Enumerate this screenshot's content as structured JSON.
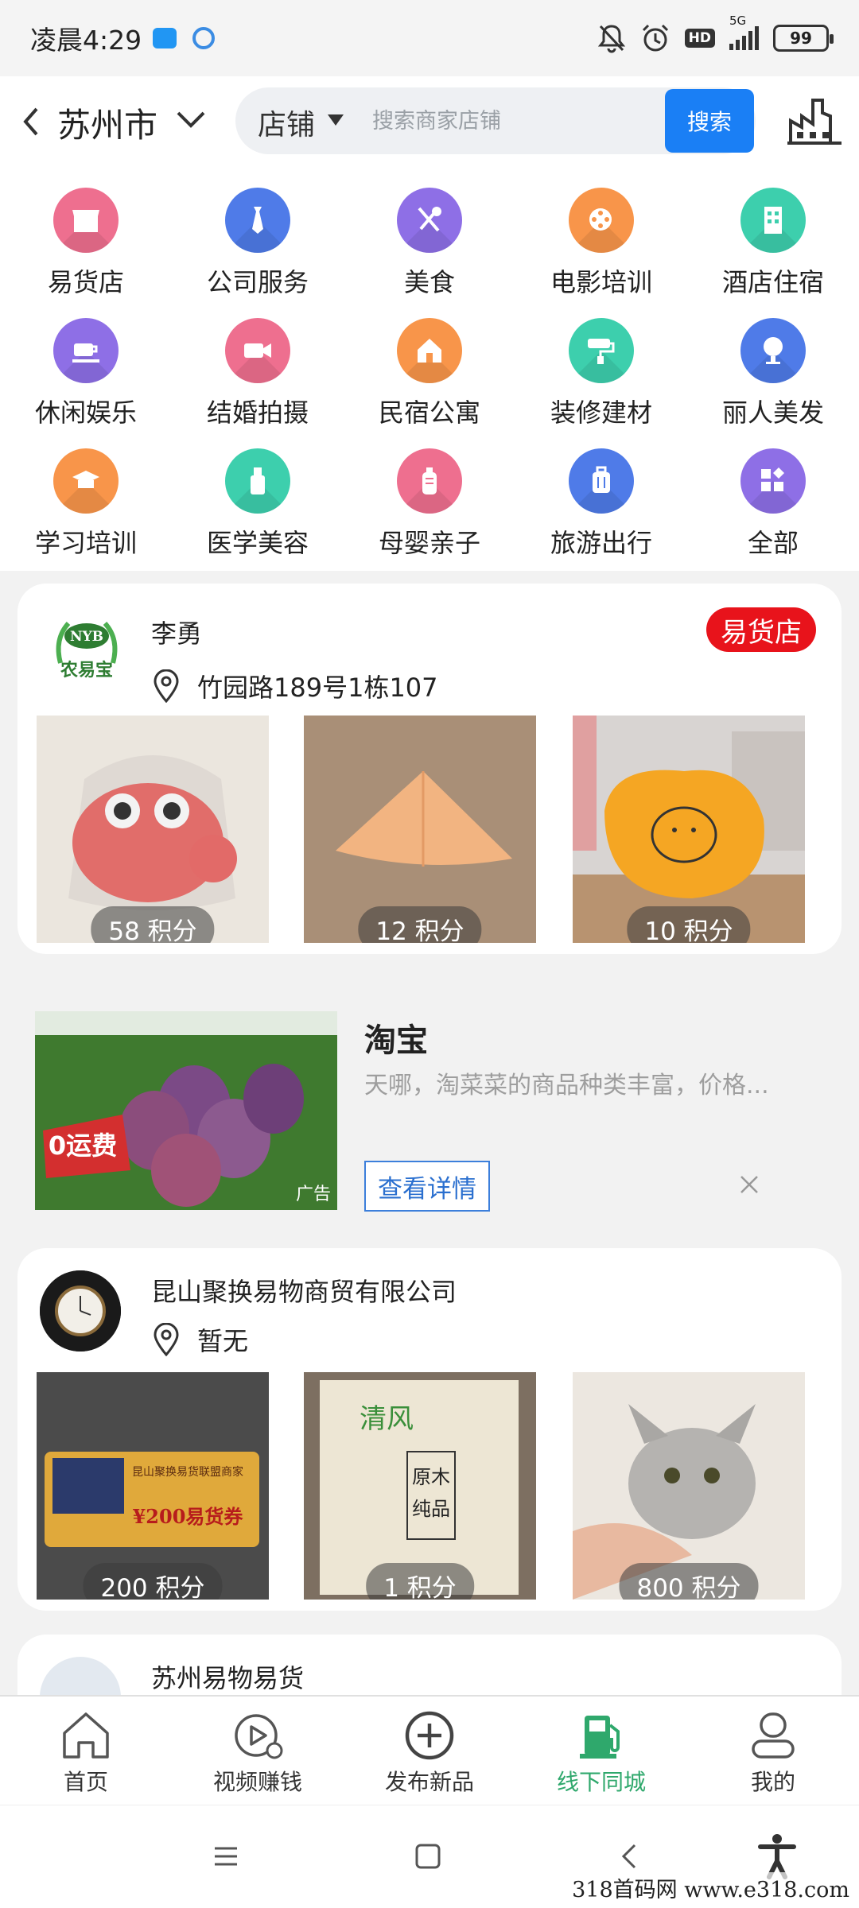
{
  "status_bar": {
    "time": "凌晨4:29",
    "network": "5G",
    "hd": "HD",
    "battery": "99"
  },
  "header": {
    "city": "苏州市",
    "search_type": "店铺",
    "search_placeholder": "搜索商家店铺",
    "search_button": "搜索"
  },
  "categories": [
    {
      "label": "易货店",
      "icon": "storefront-icon",
      "color": "#ee6f8f"
    },
    {
      "label": "公司服务",
      "icon": "tie-icon",
      "color": "#4f7be8"
    },
    {
      "label": "美食",
      "icon": "fork-spoon-icon",
      "color": "#8e6fe6"
    },
    {
      "label": "电影培训",
      "icon": "film-reel-icon",
      "color": "#f8954a"
    },
    {
      "label": "酒店住宿",
      "icon": "building-icon",
      "color": "#3dcfad"
    },
    {
      "label": "休闲娱乐",
      "icon": "cup-icon",
      "color": "#8e6fe6"
    },
    {
      "label": "结婚拍摄",
      "icon": "video-camera-icon",
      "color": "#ee6f8f"
    },
    {
      "label": "民宿公寓",
      "icon": "house-icon",
      "color": "#f8954a"
    },
    {
      "label": "装修建材",
      "icon": "paint-roller-icon",
      "color": "#3dcfad"
    },
    {
      "label": "丽人美发",
      "icon": "mirror-icon",
      "color": "#4f7be8"
    },
    {
      "label": "学习培训",
      "icon": "graduation-cap-icon",
      "color": "#f8954a"
    },
    {
      "label": "医学美容",
      "icon": "cosmetic-bottle-icon",
      "color": "#3dcfad"
    },
    {
      "label": "母婴亲子",
      "icon": "baby-bottle-icon",
      "color": "#ee6f8f"
    },
    {
      "label": "旅游出行",
      "icon": "suitcase-icon",
      "color": "#4f7be8"
    },
    {
      "label": "全部",
      "icon": "grid-icon",
      "color": "#8e6fe6"
    }
  ],
  "shops": [
    {
      "logo_text": "NYB",
      "logo_subtext": "农易宝",
      "name": "李勇",
      "address": "竹园路189号1栋107",
      "badge": "易货店",
      "products": [
        {
          "price": "58 积分",
          "desc": "pink knitted hat"
        },
        {
          "price": "12 积分",
          "desc": "orange towel"
        },
        {
          "price": "10 积分",
          "desc": "orange cushion"
        }
      ]
    },
    {
      "name": "昆山聚换易物商贸有限公司",
      "address": "暂无",
      "products": [
        {
          "price": "200 积分",
          "voucher_line1": "昆山聚换易货联盟商家",
          "voucher_line2": "¥200易货券"
        },
        {
          "price": "1 积分",
          "pack_text": "原木纯品",
          "brand": "清风"
        },
        {
          "price": "800 积分",
          "desc": "grey kitten"
        }
      ]
    },
    {
      "name": "苏州易物易货"
    }
  ],
  "ad": {
    "title": "淘宝",
    "description": "天哪，淘菜菜的商品种类丰富，价格...",
    "button": "查看详情",
    "tag": "广告",
    "promo_text": "0运费"
  },
  "bottom_nav": [
    {
      "label": "首页",
      "icon": "home-icon",
      "active": false
    },
    {
      "label": "视频赚钱",
      "icon": "video-play-icon",
      "active": false
    },
    {
      "label": "发布新品",
      "icon": "plus-circle-icon",
      "active": false
    },
    {
      "label": "线下同城",
      "icon": "gas-station-icon",
      "active": true
    },
    {
      "label": "我的",
      "icon": "user-icon",
      "active": false
    }
  ],
  "watermark": "318首码网  www.e318.com"
}
